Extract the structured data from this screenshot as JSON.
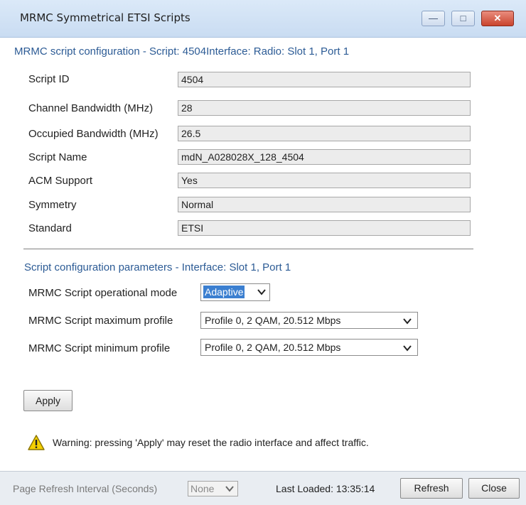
{
  "window": {
    "title": "MRMC Symmetrical ETSI Scripts",
    "controls": {
      "minimize": "—",
      "maximize": "□",
      "close": "✕"
    }
  },
  "config_section": {
    "title": "MRMC script configuration - Script: 4504Interface: Radio: Slot 1, Port 1",
    "fields": [
      {
        "label": "Script ID",
        "value": "4504"
      },
      {
        "label": "Channel Bandwidth (MHz)",
        "value": "28"
      },
      {
        "label": "Occupied Bandwidth (MHz)",
        "value": "26.5"
      },
      {
        "label": "Script Name",
        "value": "mdN_A028028X_128_4504"
      },
      {
        "label": "ACM Support",
        "value": "Yes"
      },
      {
        "label": "Symmetry",
        "value": "Normal"
      },
      {
        "label": "Standard",
        "value": "ETSI"
      }
    ]
  },
  "params_section": {
    "title": "Script configuration parameters - Interface: Slot 1, Port 1",
    "operational_mode": {
      "label": "MRMC Script operational mode",
      "value": "Adaptive"
    },
    "max_profile": {
      "label": "MRMC Script maximum profile",
      "value": "Profile 0, 2 QAM, 20.512 Mbps"
    },
    "min_profile": {
      "label": "MRMC Script minimum profile",
      "value": "Profile 0, 2 QAM, 20.512 Mbps"
    }
  },
  "apply_button": "Apply",
  "warning": {
    "text": "Warning: pressing 'Apply' may reset the radio interface and affect traffic.",
    "icon": "warning-triangle-icon"
  },
  "status_bar": {
    "refresh_label": "Page Refresh Interval (Seconds)",
    "refresh_value": "None",
    "last_loaded": "Last Loaded: 13:35:14",
    "refresh_button": "Refresh",
    "close_button": "Close"
  },
  "colors": {
    "section_title": "#2c5b95",
    "accent_selected": "#3b7fd0",
    "warning_yellow": "#f5d000"
  }
}
